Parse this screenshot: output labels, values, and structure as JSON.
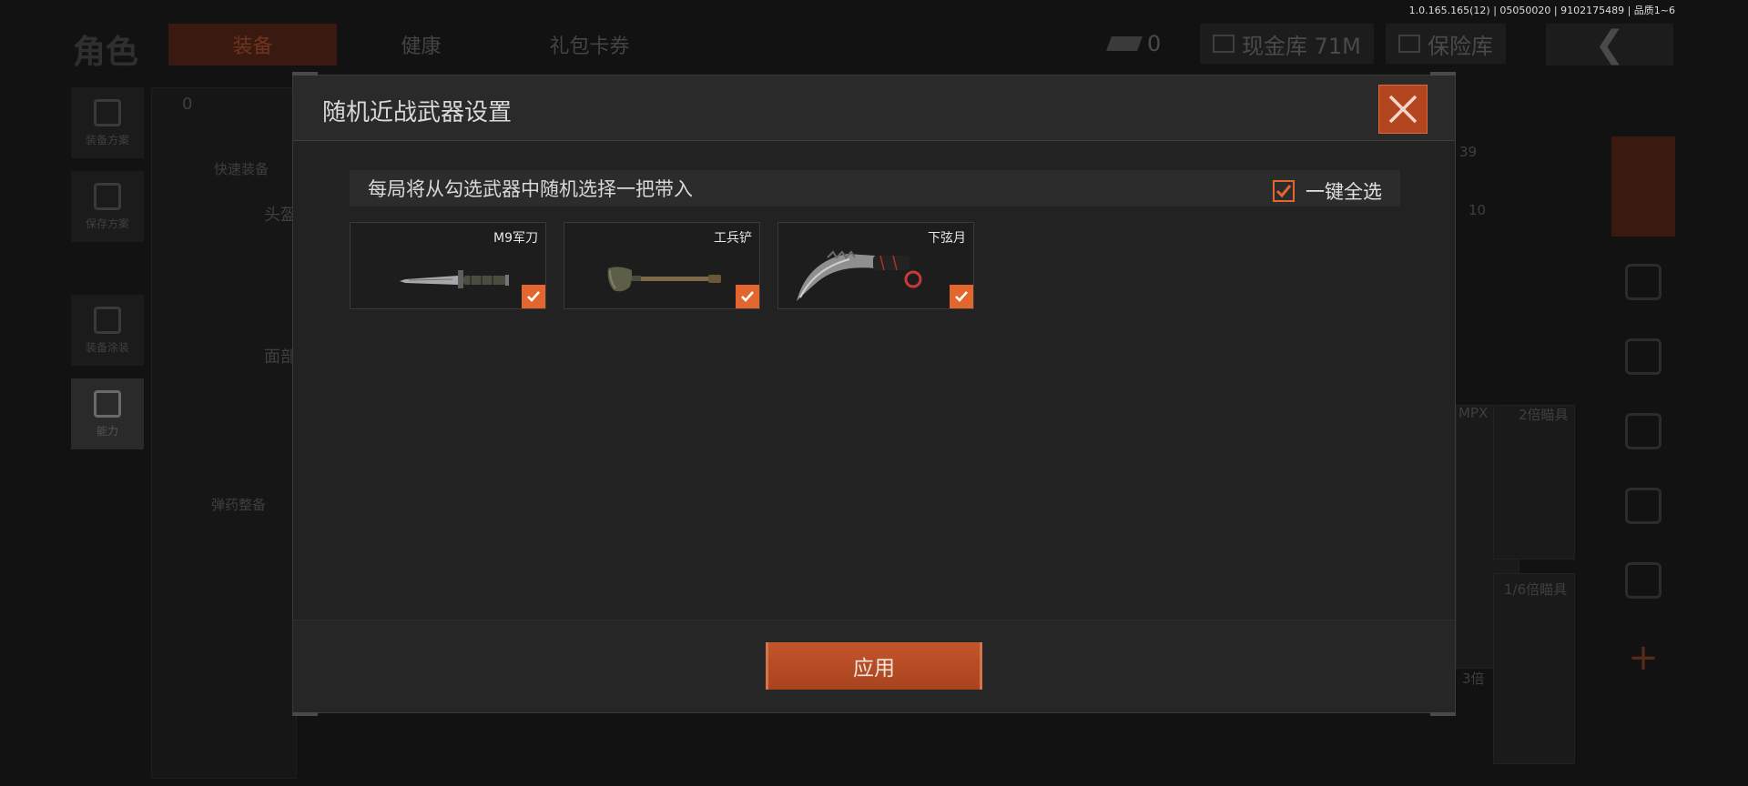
{
  "version": "1.0.165.165(12) | 05050020 | 9102175489 | 品质1~6",
  "topbar": {
    "role_title": "角色",
    "tabs": [
      {
        "label": "装备",
        "active": true
      },
      {
        "label": "健康",
        "active": false
      },
      {
        "label": "礼包卡券",
        "active": false
      }
    ],
    "ticket_count": "0",
    "cash_label": "现金库 71M",
    "vault_label": "保险库"
  },
  "leftnav": {
    "items": [
      {
        "label": "装备方案"
      },
      {
        "label": "保存方案"
      },
      {
        "label": "装备涂装"
      },
      {
        "label": "能力"
      }
    ]
  },
  "background": {
    "armor_count": "0",
    "quick_equip": "快速装备",
    "head_label": "头盔",
    "face_label": "面部",
    "ammo_label": "弹药整备",
    "right_labels": [
      "39",
      "10",
      "MPX",
      "2倍瞄具",
      "1/6倍瞄具",
      "3倍"
    ]
  },
  "modal": {
    "title": "随机近战武器设置",
    "notice": "每局将从勾选武器中随机选择一把带入",
    "select_all_label": "一键全选",
    "select_all_checked": true,
    "apply_label": "应用",
    "weapons": [
      {
        "name": "M9军刀",
        "icon": "bayonet-knife-icon",
        "checked": true
      },
      {
        "name": "工兵铲",
        "icon": "shovel-icon",
        "checked": true
      },
      {
        "name": "下弦月",
        "icon": "karambit-icon",
        "checked": true
      }
    ]
  },
  "colors": {
    "accent": "#e2662e",
    "close_bg": "#b3451f",
    "apply_bg": "#b84c24"
  }
}
